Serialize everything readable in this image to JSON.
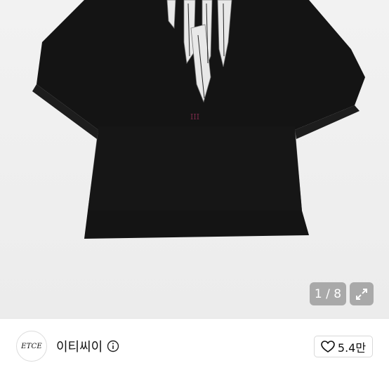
{
  "gallery": {
    "pager_text": "1 / 8",
    "expand_icon": "expand-arrows-icon"
  },
  "seller": {
    "logo_text": "ETCE",
    "name": "이티씨이",
    "info_icon": "info-circle-icon",
    "like_icon": "heart-outline-icon",
    "like_count": "5.4만"
  },
  "colors": {
    "shirt": "#121212",
    "overlay": "#9a9a9a"
  }
}
